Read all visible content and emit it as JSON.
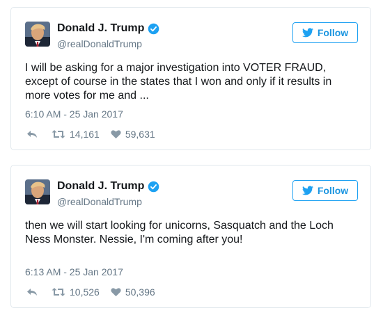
{
  "colors": {
    "accent": "#1da1f2",
    "text": "#14171a",
    "muted": "#657786",
    "border": "#e1e8ed"
  },
  "tweets": [
    {
      "name": "Donald J. Trump",
      "handle": "@realDonaldTrump",
      "follow_label": "Follow",
      "text": "I will be asking for a major investigation into VOTER FRAUD, except of course in the states that I won and only if it results in more votes for me and ...",
      "timestamp": "6:10 AM - 25 Jan 2017",
      "retweets": "14,161",
      "likes": "59,631",
      "icons": [
        "reply-icon",
        "retweet-icon",
        "like-icon",
        "verified-icon",
        "twitter-bird-icon"
      ]
    },
    {
      "name": "Donald J. Trump",
      "handle": "@realDonaldTrump",
      "follow_label": "Follow",
      "text": "then we will start looking for unicorns, Sasquatch and the Loch Ness Monster. Nessie, I'm coming after you!",
      "timestamp": "6:13 AM - 25 Jan 2017",
      "retweets": "10,526",
      "likes": "50,396",
      "icons": [
        "reply-icon",
        "retweet-icon",
        "like-icon",
        "verified-icon",
        "twitter-bird-icon"
      ]
    }
  ]
}
